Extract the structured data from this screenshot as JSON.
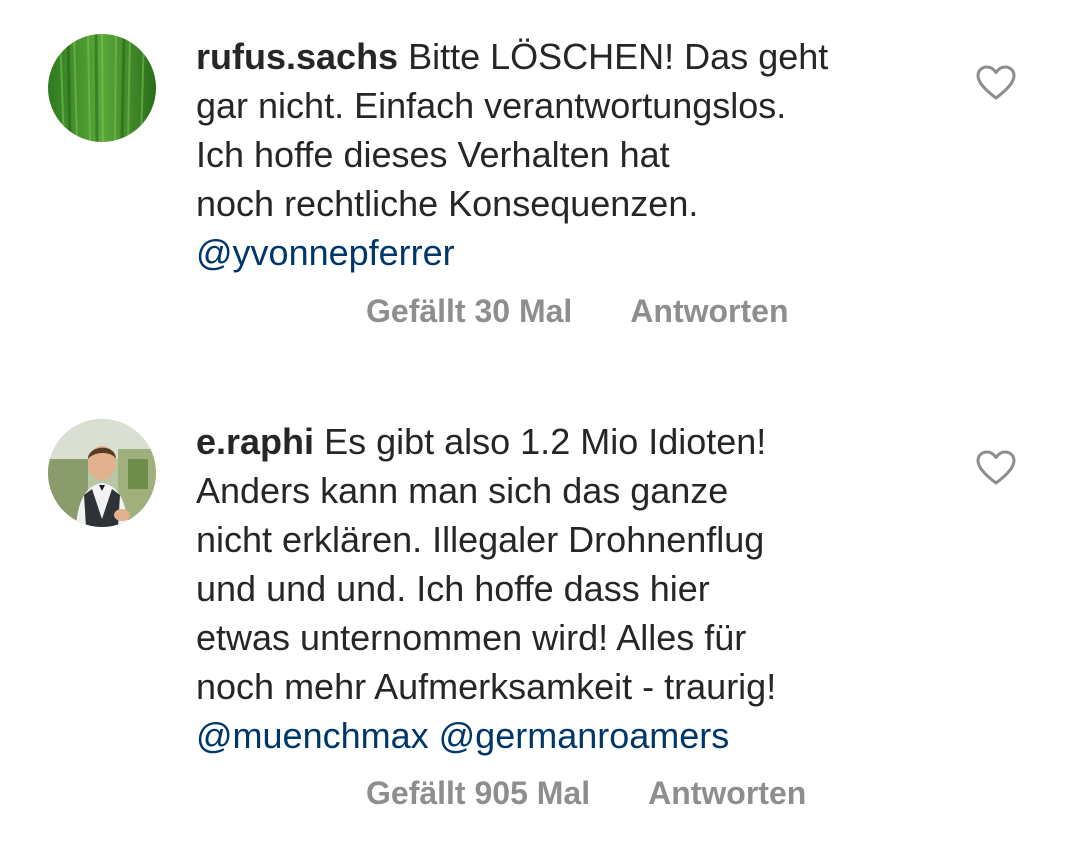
{
  "comments": [
    {
      "username": "rufus.sachs",
      "lines": [
        "Bitte LÖSCHEN! Das geht",
        "gar nicht. Einfach verantwortungslos.",
        "Ich hoffe dieses Verhalten hat",
        "noch rechtliche Konsequenzen."
      ],
      "mentions": "@yvonnepferrer",
      "likes_label": "Gefällt 30 Mal",
      "reply_label": "Antworten",
      "like_icon": "heart-outline-icon",
      "avatar": "green-leaf-avatar"
    },
    {
      "username": "e.raphi",
      "lines": [
        "Es gibt also 1.2 Mio Idioten!",
        "Anders kann man sich das ganze",
        "nicht erklären. Illegaler Drohnenflug",
        "und und und. Ich hoffe dass hier",
        "etwas unternommen wird! Alles für",
        "noch mehr Aufmerksamkeit - traurig!"
      ],
      "mentions": "@muenchmax @germanroamers",
      "likes_label": "Gefällt 905 Mal",
      "reply_label": "Antworten",
      "like_icon": "heart-outline-icon",
      "avatar": "person-photo-avatar"
    }
  ],
  "colors": {
    "text": "#262626",
    "mention": "#00376b",
    "meta": "#8e8e8e",
    "background": "#ffffff"
  }
}
